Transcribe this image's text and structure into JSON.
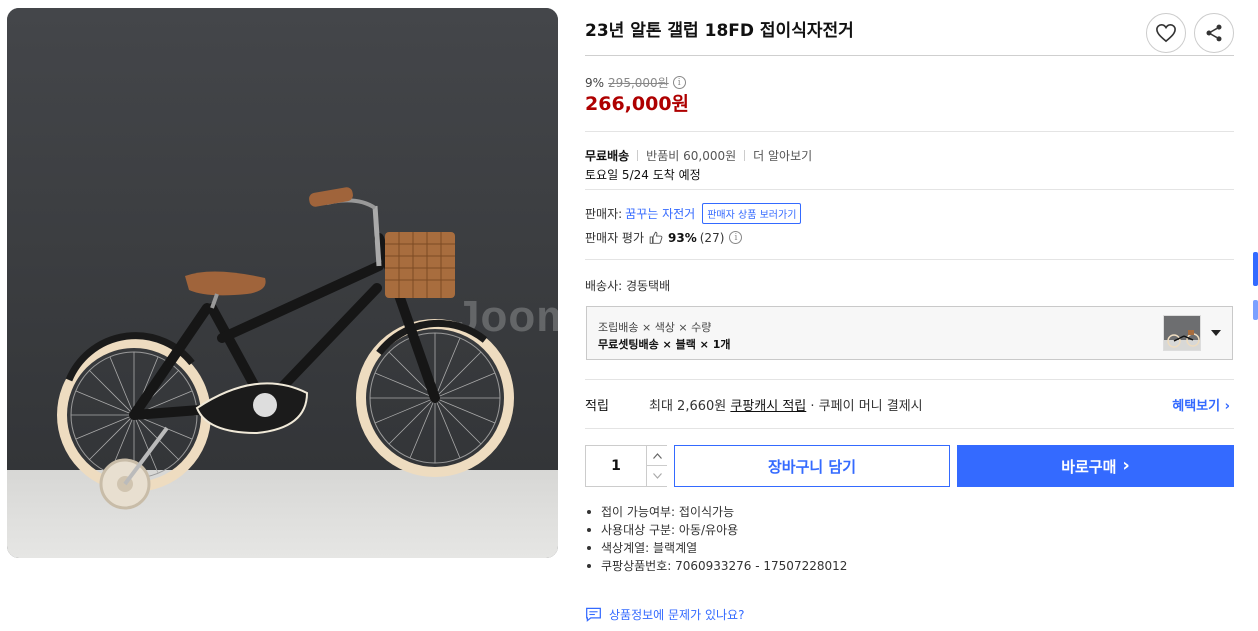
{
  "product": {
    "title": "23년 알톤 갤럽 18FD 접이식자전거",
    "image_watermark": "Joom",
    "discount_rate": "9%",
    "original_price": "295,000원",
    "sale_price": "266,000원"
  },
  "actions": {
    "wishlist_icon": "heart-icon",
    "share_icon": "share-icon"
  },
  "shipping": {
    "free_label": "무료배송",
    "return_fee": "반품비 60,000원",
    "learn_more": "더 알아보기",
    "arrival": "토요일 5/24 도착 예정"
  },
  "seller": {
    "label": "판매자:",
    "name": "꿈꾸는 자전거",
    "view_products": "판매자 상품 보러가기",
    "rating_label": "판매자 평가",
    "rating_pct": "93%",
    "rating_count": "(27)"
  },
  "courier": "배송사: 경동택배",
  "option": {
    "label": "조립배송 × 색상 × 수량",
    "value": "무료셋팅배송 × 블랙 × 1개"
  },
  "reward": {
    "label": "적립",
    "desc_prefix": "최대 2,660원 ",
    "desc_link": "쿠팡캐시 적립",
    "desc_suffix": " · 쿠페이 머니 결제시",
    "more": "혜택보기 ›"
  },
  "purchase": {
    "quantity": "1",
    "cart_label": "장바구니 담기",
    "buy_label": "바로구매",
    "buy_arrow": "›"
  },
  "specs": [
    "접이 가능여부: 접이식가능",
    "사용대상 구분: 아동/유아용",
    "색상계열: 블랙계열",
    "쿠팡상품번호: 7060933276 - 17507228012"
  ],
  "report": "상품정보에 문제가 있나요?",
  "colors": {
    "accent": "#346aff",
    "price_red": "#ae0000"
  }
}
